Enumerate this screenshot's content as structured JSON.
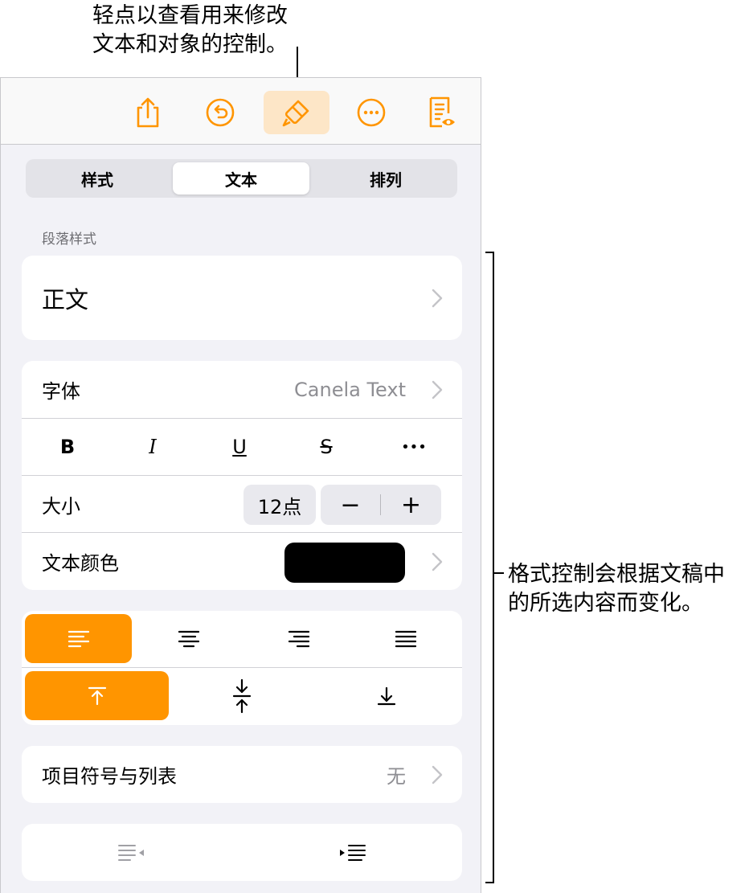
{
  "callouts": {
    "top_line1": "轻点以查看用来修改",
    "top_line2": "文本和对象的控制。",
    "right_line1": "格式控制会根据文稿中",
    "right_line2": "的所选内容而变化。"
  },
  "toolbar": {
    "icons": [
      "share-icon",
      "undo-icon",
      "format-brush-icon",
      "more-icon",
      "document-view-icon"
    ],
    "active": "format-brush-icon",
    "accent_color": "#ff9500"
  },
  "tabs": {
    "items": [
      {
        "label": "样式"
      },
      {
        "label": "文本"
      },
      {
        "label": "排列"
      }
    ],
    "selected": "文本"
  },
  "paragraph": {
    "section_label": "段落样式",
    "style_value": "正文"
  },
  "font": {
    "label": "字体",
    "value": "Canela Text",
    "styles": [
      "B",
      "I",
      "U",
      "S",
      "•••"
    ]
  },
  "size": {
    "label": "大小",
    "value": "12点",
    "minus": "−",
    "plus": "+"
  },
  "text_color": {
    "label": "文本颜色",
    "color": "#000000"
  },
  "alignment": {
    "horizontal": [
      "left",
      "center",
      "right",
      "justify"
    ],
    "horizontal_selected": "left",
    "vertical": [
      "top",
      "middle",
      "bottom"
    ],
    "vertical_selected": "top"
  },
  "bullets": {
    "label": "项目符号与列表",
    "value": "无"
  },
  "indent": {
    "buttons": [
      "decrease-indent-icon",
      "increase-indent-icon"
    ]
  }
}
